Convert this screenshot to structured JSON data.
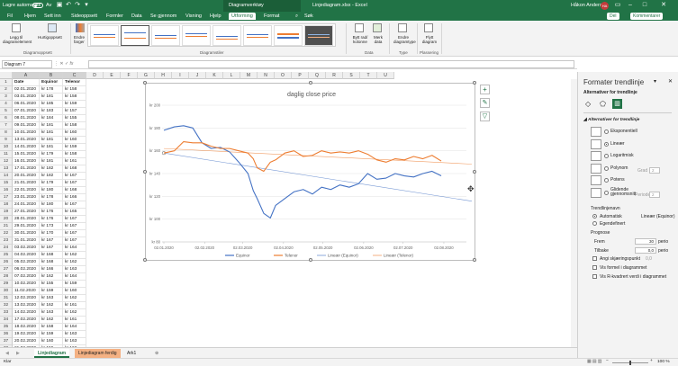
{
  "app": {
    "autosave_label": "Lagre automatisk",
    "autosave_state": "Av",
    "context_group": "Diagramverktøy",
    "doc_title": "Linjediagram.xlsx - Excel",
    "user": "Håkon Andersen",
    "user_initials": "HA"
  },
  "tabs": [
    "Fil",
    "Hjem",
    "Sett inn",
    "Sideoppsett",
    "Formler",
    "Data",
    "Se gjennom",
    "Visning",
    "Hjelp",
    "Utforming",
    "Format",
    "Søk"
  ],
  "active_tab": "Utforming",
  "share_label": "Del",
  "comments_label": "Kommentarer",
  "ribbon": {
    "add_element": "Legg til diagramelement",
    "quick_layout": "Hurtigoppsett",
    "change_colors": "Endre farger",
    "group_layouts": "Diagramoppsett",
    "group_styles": "Diagramstiler",
    "switch_rowcol": "Bytt rad/ kolonne",
    "select_data": "Merk data",
    "group_data": "Data",
    "change_type": "Endre diagramtype",
    "group_type": "Type",
    "move_chart": "Flytt diagram",
    "group_location": "Plassering"
  },
  "name_box": "Diagram 7",
  "fx_label": "fx",
  "columns": [
    "A",
    "B",
    "C",
    "D",
    "E",
    "F",
    "G",
    "H",
    "I",
    "J",
    "K",
    "L",
    "M",
    "N",
    "O",
    "P",
    "Q",
    "R",
    "S",
    "T",
    "U"
  ],
  "headers": [
    "Date",
    "Equinor",
    "Telenor"
  ],
  "rows": [
    [
      "02.01.2020",
      "kr 178",
      "kr 158"
    ],
    [
      "03.01.2020",
      "kr 181",
      "kr 158"
    ],
    [
      "06.01.2020",
      "kr 185",
      "kr 159"
    ],
    [
      "07.01.2020",
      "kr 183",
      "kr 157"
    ],
    [
      "08.01.2020",
      "kr 184",
      "kr 155"
    ],
    [
      "09.01.2020",
      "kr 181",
      "kr 158"
    ],
    [
      "10.01.2020",
      "kr 181",
      "kr 160"
    ],
    [
      "13.01.2020",
      "kr 181",
      "kr 160"
    ],
    [
      "14.01.2020",
      "kr 181",
      "kr 159"
    ],
    [
      "15.01.2020",
      "kr 179",
      "kr 158"
    ],
    [
      "16.01.2020",
      "kr 181",
      "kr 161"
    ],
    [
      "17.01.2020",
      "kr 182",
      "kr 168"
    ],
    [
      "20.01.2020",
      "kr 182",
      "kr 167"
    ],
    [
      "21.01.2020",
      "kr 179",
      "kr 167"
    ],
    [
      "22.01.2020",
      "kr 180",
      "kr 168"
    ],
    [
      "23.01.2020",
      "kr 178",
      "kr 166"
    ],
    [
      "24.01.2020",
      "kr 180",
      "kr 167"
    ],
    [
      "27.01.2020",
      "kr 176",
      "kr 165"
    ],
    [
      "28.01.2020",
      "kr 176",
      "kr 167"
    ],
    [
      "29.01.2020",
      "kr 173",
      "kr 167"
    ],
    [
      "30.01.2020",
      "kr 170",
      "kr 167"
    ],
    [
      "31.01.2020",
      "kr 167",
      "kr 167"
    ],
    [
      "03.02.2020",
      "kr 167",
      "kr 164"
    ],
    [
      "04.02.2020",
      "kr 168",
      "kr 162"
    ],
    [
      "05.02.2020",
      "kr 168",
      "kr 162"
    ],
    [
      "06.02.2020",
      "kr 166",
      "kr 163"
    ],
    [
      "07.02.2020",
      "kr 162",
      "kr 164"
    ],
    [
      "10.02.2020",
      "kr 155",
      "kr 159"
    ],
    [
      "11.02.2020",
      "kr 159",
      "kr 160"
    ],
    [
      "12.02.2020",
      "kr 163",
      "kr 162"
    ],
    [
      "13.02.2020",
      "kr 162",
      "kr 161"
    ],
    [
      "14.02.2020",
      "kr 163",
      "kr 162"
    ],
    [
      "17.02.2020",
      "kr 162",
      "kr 161"
    ],
    [
      "18.02.2020",
      "kr 158",
      "kr 164"
    ],
    [
      "19.02.2020",
      "kr 159",
      "kr 163"
    ],
    [
      "20.02.2020",
      "kr 160",
      "kr 163"
    ],
    [
      "21.02.2020",
      "kr 159",
      "kr 162"
    ]
  ],
  "chart_data": {
    "type": "line",
    "title": "daglig close price",
    "y_ticks": [
      "kr 80",
      "kr 100",
      "kr 120",
      "kr 140",
      "kr 160",
      "kr 180",
      "kr 200"
    ],
    "x_ticks": [
      "02.01.2020",
      "02.02.2020",
      "02.03.2020",
      "02.04.2020",
      "02.05.2020",
      "02.06.2020",
      "02.07.2020",
      "02.08.2020"
    ],
    "ylim": [
      80,
      200
    ],
    "x": [
      "2020-01-02",
      "2020-01-10",
      "2020-01-17",
      "2020-01-24",
      "2020-01-31",
      "2020-02-07",
      "2020-02-14",
      "2020-02-21",
      "2020-02-28",
      "2020-03-06",
      "2020-03-10",
      "2020-03-13",
      "2020-03-18",
      "2020-03-23",
      "2020-03-27",
      "2020-04-03",
      "2020-04-10",
      "2020-04-17",
      "2020-04-24",
      "2020-05-01",
      "2020-05-08",
      "2020-05-15",
      "2020-05-22",
      "2020-05-29",
      "2020-06-05",
      "2020-06-12",
      "2020-06-19",
      "2020-06-26",
      "2020-07-03",
      "2020-07-10",
      "2020-07-17",
      "2020-07-24",
      "2020-07-31"
    ],
    "series": [
      {
        "name": "Equinor",
        "color": "#4472c4",
        "values": [
          178,
          181,
          182,
          180,
          167,
          162,
          163,
          159,
          150,
          140,
          125,
          118,
          105,
          101,
          112,
          118,
          124,
          126,
          122,
          128,
          126,
          130,
          128,
          131,
          140,
          135,
          136,
          140,
          138,
          137,
          140,
          142,
          138
        ]
      },
      {
        "name": "Telenor",
        "color": "#ed7d31",
        "values": [
          158,
          160,
          168,
          167,
          167,
          164,
          162,
          162,
          160,
          158,
          153,
          145,
          142,
          150,
          152,
          158,
          160,
          155,
          156,
          160,
          158,
          159,
          158,
          160,
          157,
          152,
          150,
          153,
          152,
          155,
          153,
          156,
          151
        ]
      }
    ],
    "trendlines": [
      {
        "name": "Lineær (Equinor)",
        "color": "#4472c4",
        "start": 158,
        "end": 121
      },
      {
        "name": "Lineær (Telenor)",
        "color": "#ed7d31",
        "start": 162,
        "end": 150
      }
    ],
    "legend_position": "bottom"
  },
  "sheet_tabs": [
    "Linjediagram",
    "Linjediagram ferdig",
    "Ark1"
  ],
  "active_sheet": "Linjediagram",
  "status": "Klar",
  "zoom": "100 %",
  "pane": {
    "title": "Formater trendlinje",
    "subtitle": "Alternativer for trendlinje",
    "section": "Alternativer for trendlinje",
    "types": [
      "Eksponentiell",
      "Lineær",
      "Logaritmisk",
      "Polynom",
      "Potens",
      "Glidende gjennomsnitt"
    ],
    "selected_type": "Lineær",
    "order_label": "Grad",
    "order_value": "2",
    "period_label": "Periode",
    "period_value": "2",
    "name_heading": "Trendlinjenavn",
    "auto_label": "Automatisk",
    "auto_value": "Lineær (Equinor)",
    "custom_label": "Egendefinert",
    "forecast_heading": "Prognose",
    "forward_label": "Frem",
    "forward_value": "30",
    "backward_label": "Tilbake",
    "backward_value": "0,0",
    "period_unit": "perio",
    "intercept_label": "Angi skjæringspunkt",
    "intercept_value": "0,0",
    "show_equation": "Vis formel i diagrammet",
    "show_r2": "Vis R-kvadrert verdi i diagrammet"
  }
}
